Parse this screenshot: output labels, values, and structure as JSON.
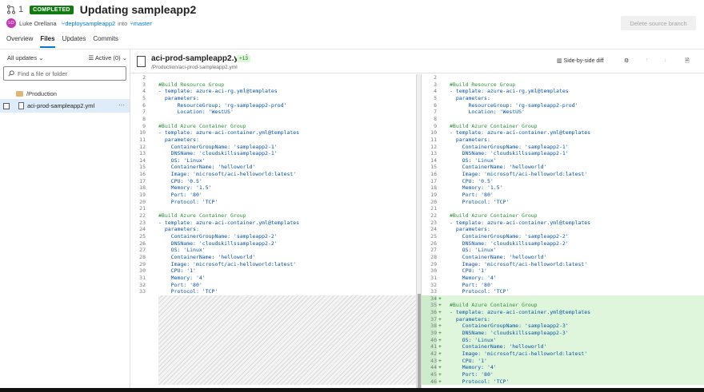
{
  "header": {
    "pr_number": "1",
    "status_badge": "COMPLETED",
    "title": "Updating sampleapp2",
    "author_initials": "LO",
    "author": "Luke Orellana",
    "source_branch": "deploysampleapp2",
    "into_label": "into",
    "target_branch": "master",
    "delete_branch_label": "Delete source branch"
  },
  "tabs": [
    {
      "label": "Overview"
    },
    {
      "label": "Files"
    },
    {
      "label": "Updates"
    },
    {
      "label": "Commits"
    }
  ],
  "sidebar": {
    "updates_filter": "All updates",
    "active_filter": "Active (0)",
    "search_placeholder": "Find a file or folder",
    "folder": "/Production",
    "file": "aci-prod-sampleapp2.yml",
    "more": "···"
  },
  "diff_header": {
    "file_name": "aci-prod-sampleapp2.yml",
    "added_count": "+13",
    "path": "/Production/aci-prod-sampleapp2.yml",
    "view_mode": "Side-by-side diff"
  },
  "colors": {
    "accent": "#0078d4",
    "completed_badge": "#107c10",
    "added_bg": "#dff6dd",
    "avatar": "#c239b3"
  },
  "icons": [
    "pull-request-icon",
    "branch-icon",
    "search-icon",
    "folder-icon",
    "file-icon",
    "side-by-side-icon",
    "gear-icon",
    "arrow-up-icon",
    "arrow-down-icon",
    "notes-icon",
    "chevron-down-icon",
    "filter-icon"
  ],
  "left_lines": [
    {
      "n": "2",
      "t": "",
      "k": "plain"
    },
    {
      "n": "3",
      "t": "#Build Resource Group",
      "k": "cmt"
    },
    {
      "n": "4",
      "t": "- template: azure-aci-rg.yml@templates",
      "k": "key"
    },
    {
      "n": "5",
      "t": "  parameters:",
      "k": "key"
    },
    {
      "n": "6",
      "t": "      ResourceGroup: 'rg-sampleapp2-prod'",
      "k": "key"
    },
    {
      "n": "7",
      "t": "      Location: 'WestUS'",
      "k": "key"
    },
    {
      "n": "8",
      "t": "",
      "k": "plain"
    },
    {
      "n": "9",
      "t": "#Build Azure Container Group",
      "k": "cmt"
    },
    {
      "n": "10",
      "t": "- template: azure-aci-container.yml@templates",
      "k": "key"
    },
    {
      "n": "11",
      "t": "  parameters:",
      "k": "key"
    },
    {
      "n": "12",
      "t": "    ContainerGroupName: 'sampleapp2-1'",
      "k": "key"
    },
    {
      "n": "13",
      "t": "    DNSName: 'cloudskillssampleapp2-1'",
      "k": "key"
    },
    {
      "n": "14",
      "t": "    OS: 'Linux'",
      "k": "key"
    },
    {
      "n": "15",
      "t": "    ContainerName: 'helloworld'",
      "k": "key"
    },
    {
      "n": "16",
      "t": "    Image: 'microsoft/aci-helloworld:latest'",
      "k": "key"
    },
    {
      "n": "17",
      "t": "    CPU: '0.5'",
      "k": "key"
    },
    {
      "n": "18",
      "t": "    Memory: '1.5'",
      "k": "key"
    },
    {
      "n": "19",
      "t": "    Port: '80'",
      "k": "key"
    },
    {
      "n": "20",
      "t": "    Protocol: 'TCP'",
      "k": "key"
    },
    {
      "n": "21",
      "t": "",
      "k": "plain"
    },
    {
      "n": "22",
      "t": "#Build Azure Container Group",
      "k": "cmt"
    },
    {
      "n": "23",
      "t": "- template: azure-aci-container.yml@templates",
      "k": "key"
    },
    {
      "n": "24",
      "t": "  parameters:",
      "k": "key"
    },
    {
      "n": "25",
      "t": "    ContainerGroupName: 'sampleapp2-2'",
      "k": "key"
    },
    {
      "n": "26",
      "t": "    DNSName: 'cloudskillssampleapp2-2'",
      "k": "key"
    },
    {
      "n": "27",
      "t": "    OS: 'Linux'",
      "k": "key"
    },
    {
      "n": "28",
      "t": "    ContainerName: 'helloworld'",
      "k": "key"
    },
    {
      "n": "29",
      "t": "    Image: 'microsoft/aci-helloworld:latest'",
      "k": "key"
    },
    {
      "n": "30",
      "t": "    CPU: '1'",
      "k": "key"
    },
    {
      "n": "31",
      "t": "    Memory: '4'",
      "k": "key"
    },
    {
      "n": "32",
      "t": "    Port: '80'",
      "k": "key"
    },
    {
      "n": "33",
      "t": "    Protocol: 'TCP'",
      "k": "key"
    }
  ],
  "right_lines": [
    {
      "n": "2",
      "t": "",
      "k": "plain",
      "a": false
    },
    {
      "n": "3",
      "t": "#Build Resource Group",
      "k": "cmt",
      "a": false
    },
    {
      "n": "4",
      "t": "- template: azure-aci-rg.yml@templates",
      "k": "key",
      "a": false
    },
    {
      "n": "5",
      "t": "  parameters:",
      "k": "key",
      "a": false
    },
    {
      "n": "6",
      "t": "      ResourceGroup: 'rg-sampleapp2-prod'",
      "k": "key",
      "a": false
    },
    {
      "n": "7",
      "t": "      Location: 'WestUS'",
      "k": "key",
      "a": false
    },
    {
      "n": "8",
      "t": "",
      "k": "plain",
      "a": false
    },
    {
      "n": "9",
      "t": "#Build Azure Container Group",
      "k": "cmt",
      "a": false
    },
    {
      "n": "10",
      "t": "- template: azure-aci-container.yml@templates",
      "k": "key",
      "a": false
    },
    {
      "n": "11",
      "t": "  parameters:",
      "k": "key",
      "a": false
    },
    {
      "n": "12",
      "t": "    ContainerGroupName: 'sampleapp2-1'",
      "k": "key",
      "a": false
    },
    {
      "n": "13",
      "t": "    DNSName: 'cloudskillssampleapp2-1'",
      "k": "key",
      "a": false
    },
    {
      "n": "14",
      "t": "    OS: 'Linux'",
      "k": "key",
      "a": false
    },
    {
      "n": "15",
      "t": "    ContainerName: 'helloworld'",
      "k": "key",
      "a": false
    },
    {
      "n": "16",
      "t": "    Image: 'microsoft/aci-helloworld:latest'",
      "k": "key",
      "a": false
    },
    {
      "n": "17",
      "t": "    CPU: '0.5'",
      "k": "key",
      "a": false
    },
    {
      "n": "18",
      "t": "    Memory: '1.5'",
      "k": "key",
      "a": false
    },
    {
      "n": "19",
      "t": "    Port: '80'",
      "k": "key",
      "a": false
    },
    {
      "n": "20",
      "t": "    Protocol: 'TCP'",
      "k": "key",
      "a": false
    },
    {
      "n": "21",
      "t": "",
      "k": "plain",
      "a": false
    },
    {
      "n": "22",
      "t": "#Build Azure Container Group",
      "k": "cmt",
      "a": false
    },
    {
      "n": "23",
      "t": "- template: azure-aci-container.yml@templates",
      "k": "key",
      "a": false
    },
    {
      "n": "24",
      "t": "  parameters:",
      "k": "key",
      "a": false
    },
    {
      "n": "25",
      "t": "    ContainerGroupName: 'sampleapp2-2'",
      "k": "key",
      "a": false
    },
    {
      "n": "26",
      "t": "    DNSName: 'cloudskillssampleapp2-2'",
      "k": "key",
      "a": false
    },
    {
      "n": "27",
      "t": "    OS: 'Linux'",
      "k": "key",
      "a": false
    },
    {
      "n": "28",
      "t": "    ContainerName: 'helloworld'",
      "k": "key",
      "a": false
    },
    {
      "n": "29",
      "t": "    Image: 'microsoft/aci-helloworld:latest'",
      "k": "key",
      "a": false
    },
    {
      "n": "30",
      "t": "    CPU: '1'",
      "k": "key",
      "a": false
    },
    {
      "n": "31",
      "t": "    Memory: '4'",
      "k": "key",
      "a": false
    },
    {
      "n": "32",
      "t": "    Port: '80'",
      "k": "key",
      "a": false
    },
    {
      "n": "33",
      "t": "    Protocol: 'TCP'",
      "k": "key",
      "a": false
    },
    {
      "n": "34",
      "t": "",
      "k": "plain",
      "a": true
    },
    {
      "n": "35",
      "t": "#Build Azure Container Group",
      "k": "cmt",
      "a": true
    },
    {
      "n": "36",
      "t": "- template: azure-aci-container.yml@templates",
      "k": "key",
      "a": true
    },
    {
      "n": "37",
      "t": "  parameters:",
      "k": "key",
      "a": true
    },
    {
      "n": "38",
      "t": "    ContainerGroupName: 'sampleapp2-3'",
      "k": "key",
      "a": true
    },
    {
      "n": "39",
      "t": "    DNSName: 'cloudskillssampleapp2-3'",
      "k": "key",
      "a": true
    },
    {
      "n": "40",
      "t": "    OS: 'Linux'",
      "k": "key",
      "a": true
    },
    {
      "n": "41",
      "t": "    ContainerName: 'helloworld'",
      "k": "key",
      "a": true
    },
    {
      "n": "42",
      "t": "    Image: 'microsoft/aci-helloworld:latest'",
      "k": "key",
      "a": true
    },
    {
      "n": "43",
      "t": "    CPU: '1'",
      "k": "key",
      "a": true
    },
    {
      "n": "44",
      "t": "    Memory: '4'",
      "k": "key",
      "a": true
    },
    {
      "n": "45",
      "t": "    Port: '80'",
      "k": "key",
      "a": true
    },
    {
      "n": "46",
      "t": "    Protocol: 'TCP'",
      "k": "key",
      "a": true
    }
  ]
}
